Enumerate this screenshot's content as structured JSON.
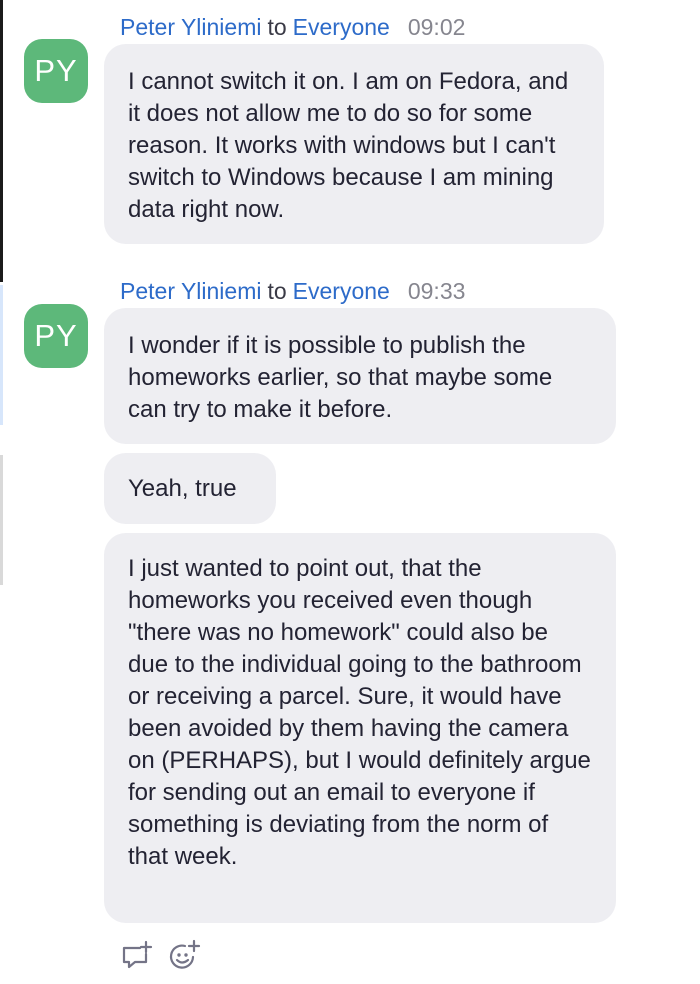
{
  "messages": [
    {
      "sender": "Peter Yliniemi",
      "to_word": "to",
      "recipient": "Everyone",
      "time": "09:02",
      "avatar_initials": "PY",
      "bubbles": [
        "I cannot switch it on. I am on Fedora, and it does not allow me to do so for some reason. It works with windows but I can't switch to Windows because I am mining data right now."
      ]
    },
    {
      "sender": "Peter Yliniemi",
      "to_word": "to",
      "recipient": "Everyone",
      "time": "09:33",
      "avatar_initials": "PY",
      "bubbles": [
        "I wonder if it is possible to publish the homeworks earlier, so that maybe some can try to make it before.",
        "Yeah, true",
        "I just wanted to point out, that the homeworks you received even though \"there was no homework\" could also be due to the individual going to the bathroom or receiving a parcel. Sure, it would have been avoided by them having the camera on (PERHAPS), but I would definitely argue for sending out an email to everyone if something is deviating from the norm of that week."
      ]
    }
  ],
  "footer": {
    "icons": [
      "reply-in-thread-icon",
      "add-reaction-icon"
    ]
  },
  "colors": {
    "link": "#2d6bc9",
    "avatar": "#5db87a",
    "bubble": "#eeeef2",
    "timestamp": "#86868f"
  }
}
